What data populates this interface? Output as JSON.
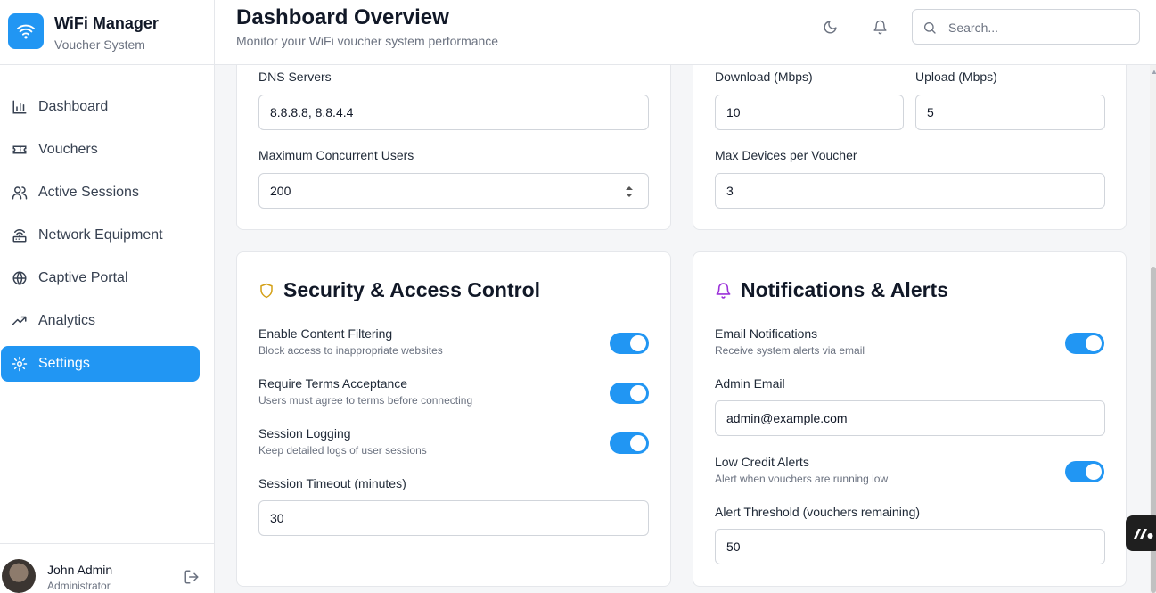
{
  "brand": {
    "title": "WiFi Manager",
    "subtitle": "Voucher System"
  },
  "nav": [
    {
      "label": "Dashboard",
      "icon": "bar-chart-icon"
    },
    {
      "label": "Vouchers",
      "icon": "ticket-icon"
    },
    {
      "label": "Active Sessions",
      "icon": "users-icon"
    },
    {
      "label": "Network Equipment",
      "icon": "router-icon"
    },
    {
      "label": "Captive Portal",
      "icon": "globe-icon"
    },
    {
      "label": "Analytics",
      "icon": "trending-up-icon"
    },
    {
      "label": "Settings",
      "icon": "gear-icon",
      "active": true
    }
  ],
  "user": {
    "name": "John Admin",
    "role": "Administrator"
  },
  "header": {
    "title": "Dashboard Overview",
    "subtitle": "Monitor your WiFi voucher system performance",
    "search_placeholder": "Search..."
  },
  "network": {
    "dns_label": "DNS Servers",
    "dns_value": "8.8.8.8, 8.8.4.4",
    "max_users_label": "Maximum Concurrent Users",
    "max_users_value": "200"
  },
  "bandwidth": {
    "download_label": "Download (Mbps)",
    "download_value": "10",
    "upload_label": "Upload (Mbps)",
    "upload_value": "5",
    "max_devices_label": "Max Devices per Voucher",
    "max_devices_value": "3"
  },
  "security": {
    "title": "Security & Access Control",
    "content_filtering_label": "Enable Content Filtering",
    "content_filtering_hint": "Block access to inappropriate websites",
    "terms_label": "Require Terms Acceptance",
    "terms_hint": "Users must agree to terms before connecting",
    "logging_label": "Session Logging",
    "logging_hint": "Keep detailed logs of user sessions",
    "timeout_label": "Session Timeout (minutes)",
    "timeout_value": "30"
  },
  "notifications": {
    "title": "Notifications & Alerts",
    "email_label": "Email Notifications",
    "email_hint": "Receive system alerts via email",
    "admin_email_label": "Admin Email",
    "admin_email_value": "admin@example.com",
    "low_credit_label": "Low Credit Alerts",
    "low_credit_hint": "Alert when vouchers are running low",
    "threshold_label": "Alert Threshold (vouchers remaining)",
    "threshold_value": "50"
  },
  "colors": {
    "accent": "#2196f3",
    "shield": "#d4a017",
    "bell": "#9b30d9"
  }
}
